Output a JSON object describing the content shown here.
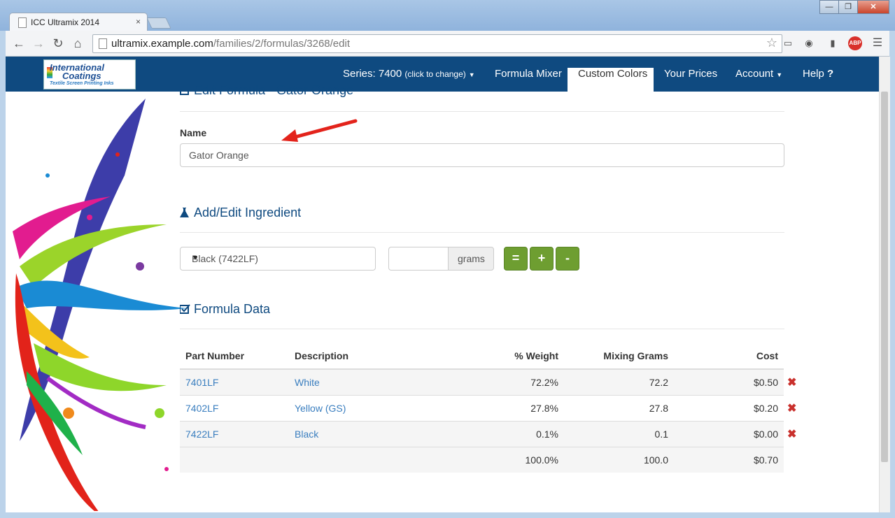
{
  "browser": {
    "tab_title": "ICC Ultramix 2014",
    "tab_close": "×",
    "url_host": "ultramix.example.com",
    "url_path": "/families/2/formulas/3268/edit",
    "window_buttons": [
      "—",
      "❐",
      "✕"
    ],
    "abp_label": "ABP"
  },
  "navbar": {
    "logo_line1": "International",
    "logo_line2": "Coatings",
    "logo_line3": "Textile Screen Printing Inks",
    "series_label": "Series: 7400",
    "series_hint": "(click to change)",
    "formula_mixer": "Formula Mixer",
    "custom_colors": "Custom Colors",
    "your_prices": "Your Prices",
    "account": "Account",
    "help": "Help",
    "help_icon": "?"
  },
  "edit": {
    "heading": "Edit Formula - Gator Orange",
    "name_label": "Name",
    "name_value": "Gator Orange"
  },
  "ingredient": {
    "heading": "Add/Edit Ingredient",
    "selected": "Black (7422LF)",
    "grams_value": "",
    "grams_addon": "grams",
    "buttons": [
      "=",
      "+",
      "-"
    ]
  },
  "formula": {
    "heading": "Formula Data",
    "columns": [
      "Part Number",
      "Description",
      "% Weight",
      "Mixing Grams",
      "Cost"
    ],
    "rows": [
      {
        "part": "7401LF",
        "desc": "White",
        "weight": "72.2%",
        "grams": "72.2",
        "cost": "$0.50"
      },
      {
        "part": "7402LF",
        "desc": "Yellow (GS)",
        "weight": "27.8%",
        "grams": "27.8",
        "cost": "$0.20"
      },
      {
        "part": "7422LF",
        "desc": "Black",
        "weight": "0.1%",
        "grams": "0.1",
        "cost": "$0.00"
      }
    ],
    "totals": {
      "weight": "100.0%",
      "grams": "100.0",
      "cost": "$0.70"
    },
    "delete_glyph": "✖"
  },
  "colors": {
    "navbar": "#0f4a80",
    "accent_green": "#6e9e31",
    "link_blue": "#3a7ebf",
    "delete_red": "#c9302c",
    "annotation_red": "#e3231b"
  }
}
